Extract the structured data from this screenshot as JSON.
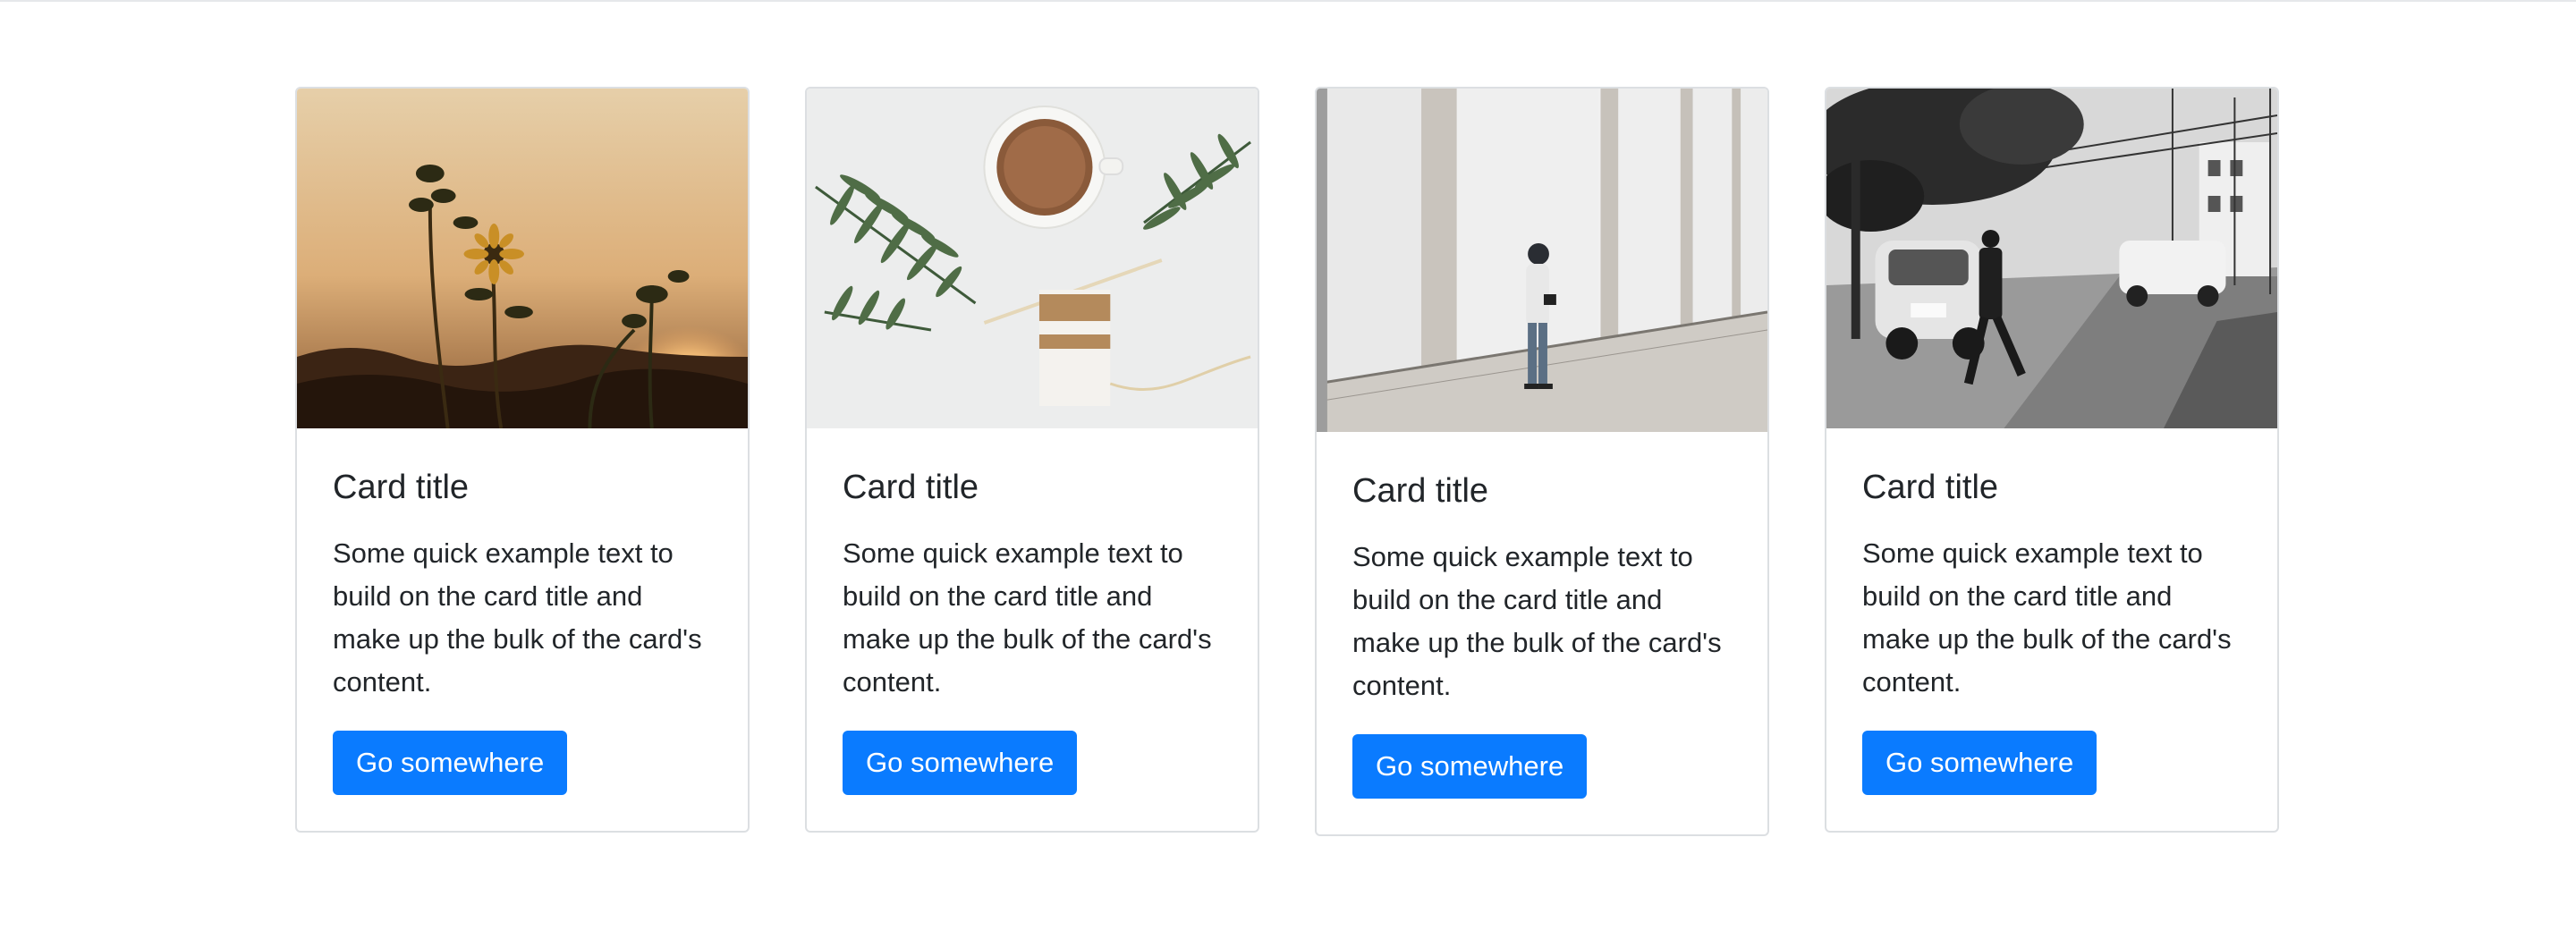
{
  "cards": [
    {
      "title": "Card title",
      "text": "Some quick example text to build on the card title and make up the bulk of the card's content.",
      "button": "Go somewhere"
    },
    {
      "title": "Card title",
      "text": "Some quick example text to build on the card title and make up the bulk of the card's content.",
      "button": "Go somewhere"
    },
    {
      "title": "Card title",
      "text": "Some quick example text to build on the card title and make up the bulk of the card's content.",
      "button": "Go somewhere"
    },
    {
      "title": "Card title",
      "text": "Some quick example text to build on the card title and make up the bulk of the card's content.",
      "button": "Go somewhere"
    }
  ],
  "colors": {
    "button": "#0a7bff",
    "border": "#dcdfe2",
    "text": "#212529"
  }
}
